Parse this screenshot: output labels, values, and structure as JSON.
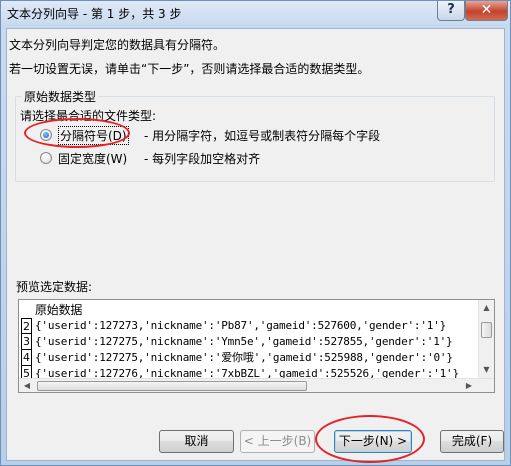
{
  "window": {
    "title": "文本分列向导 - 第 1 步，共 3 步",
    "help_label": "?",
    "close_label": "✕"
  },
  "intro": {
    "line1": "文本分列向导判定您的数据具有分隔符。",
    "line2": "若一切设置无误，请单击“下一步”，否则请选择最合适的数据类型。"
  },
  "original_type": {
    "legend": "原始数据类型",
    "prompt": "请选择最合适的文件类型:",
    "options": [
      {
        "label": "分隔符号(D)",
        "description": "- 用分隔字符，如逗号或制表符分隔每个字段",
        "checked": true
      },
      {
        "label": "固定宽度(W)",
        "description": "- 每列字段加空格对齐",
        "checked": false
      }
    ]
  },
  "preview": {
    "label": "预览选定数据:",
    "rows": [
      {
        "num": "1",
        "text": "原始数据"
      },
      {
        "num": "2",
        "text": "{'userid':127273,'nickname':'Pb87','gameid':527600,'gender':'1'}"
      },
      {
        "num": "3",
        "text": "{'userid':127275,'nickname':'Ymn5e','gameid':527855,'gender':'1'}"
      },
      {
        "num": "4",
        "text": "{'userid':127275,'nickname':'爱你哦','gameid':525988,'gender':'0'}"
      },
      {
        "num": "5",
        "text": "{'userid':127276,'nickname':'7xbBZL','gameid':525526,'gender':'1'}"
      }
    ]
  },
  "buttons": {
    "cancel": "取消",
    "back": "< 上一步(B)",
    "next": "下一步(N) >",
    "finish": "完成(F)"
  },
  "colors": {
    "highlight_ring": "#e3222a",
    "title_bar": "#c7d9ef",
    "dialog_bg": "#f0f0f0"
  }
}
